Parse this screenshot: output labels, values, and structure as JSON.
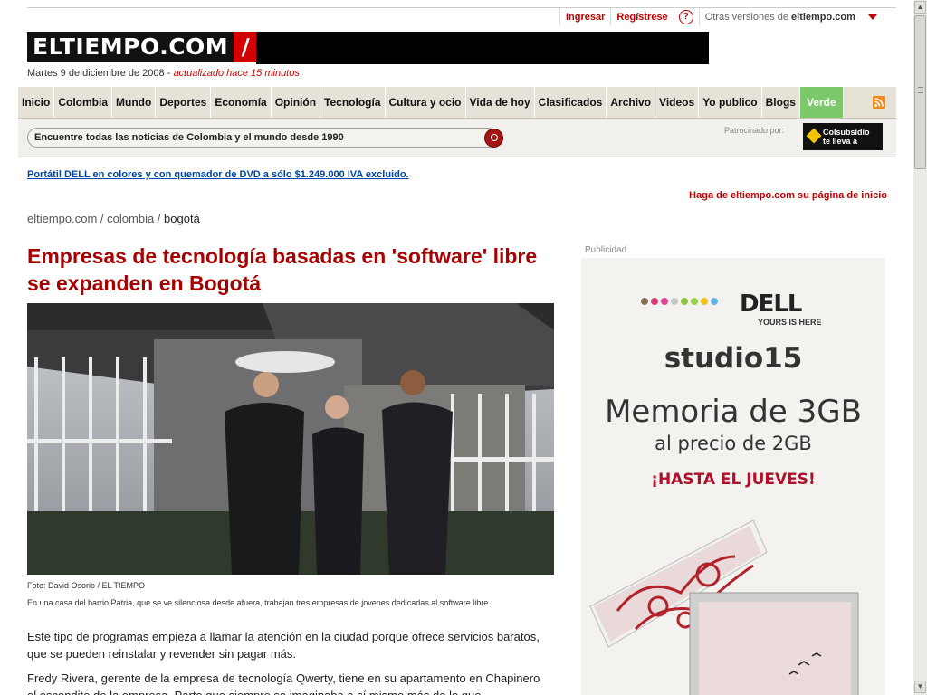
{
  "header": {
    "login": "Ingresar",
    "register": "Regístrese",
    "help_icon": "?",
    "other_versions_label": "Otras versiones de",
    "other_versions_site": "eltiempo.com",
    "logo_text": "ELTIEMPO.COM",
    "logo_slash": "/",
    "date": "Martes 9 de diciembre de 2008 -",
    "updated": "actualizado hace 15 minutos"
  },
  "nav": {
    "items": [
      "Inicio",
      "Colombia",
      "Mundo",
      "Deportes",
      "Economía",
      "Opinión",
      "Tecnología",
      "Cultura y ocio",
      "Vida de hoy",
      "Clasificados",
      "Archivo",
      "Videos",
      "Yo publico",
      "Blogs",
      "Verde"
    ],
    "rss_icon": "rss-icon"
  },
  "search": {
    "text": "Encuentre todas las noticias de Colombia y el mundo desde 1990",
    "sponsored_label": "Patrocinado por:",
    "sponsor_line1": "Colsubsidio",
    "sponsor_line2": "te lleva a"
  },
  "promo_link": "Portátil DELL en colores y con quemador de DVD a sólo $1.249.000 IVA excluido.",
  "homepage_link": "Haga de eltiempo.com su página de inicio",
  "breadcrumb": {
    "home": "eltiempo.com",
    "sep1": " / ",
    "section": "colombia",
    "sep2": " / ",
    "current": "bogotá"
  },
  "article": {
    "headline": "Empresas de tecnología basadas en 'software' libre se expanden en Bogotá",
    "photo_credit": "Foto: David Osorio / EL TIEMPO",
    "photo_caption": "En una casa del barrio Patria, que se ve silenciosa desde afuera, trabajan tres empresas de jovenes dedicadas al software libre.",
    "paragraph1": "Este tipo de programas empieza a llamar la atención en la ciudad porque ofrece servicios baratos, que se pueden reinstalar y revender sin pagar más.",
    "paragraph2": "Fredy Rivera, gerente de la empresa de tecnología Qwerty,  tiene en su apartamento en Chapinero el escondite de la empresa. Parte que siempre se imaginaba a sí mismo más de lo que"
  },
  "ad": {
    "label": "Publicidad",
    "brand": "DELL",
    "tagline": "YOURS IS HERE",
    "product": "studio15",
    "line1": "Memoria de 3GB",
    "line2": "al precio de 2GB",
    "line3": "¡HASTA EL JUEVES!",
    "dot_colors": [
      "#8a6d55",
      "#e03a76",
      "#e9439b",
      "#c7c7c7",
      "#8cc63f",
      "#9ad14b",
      "#f7c21c",
      "#5bb6e5"
    ]
  }
}
